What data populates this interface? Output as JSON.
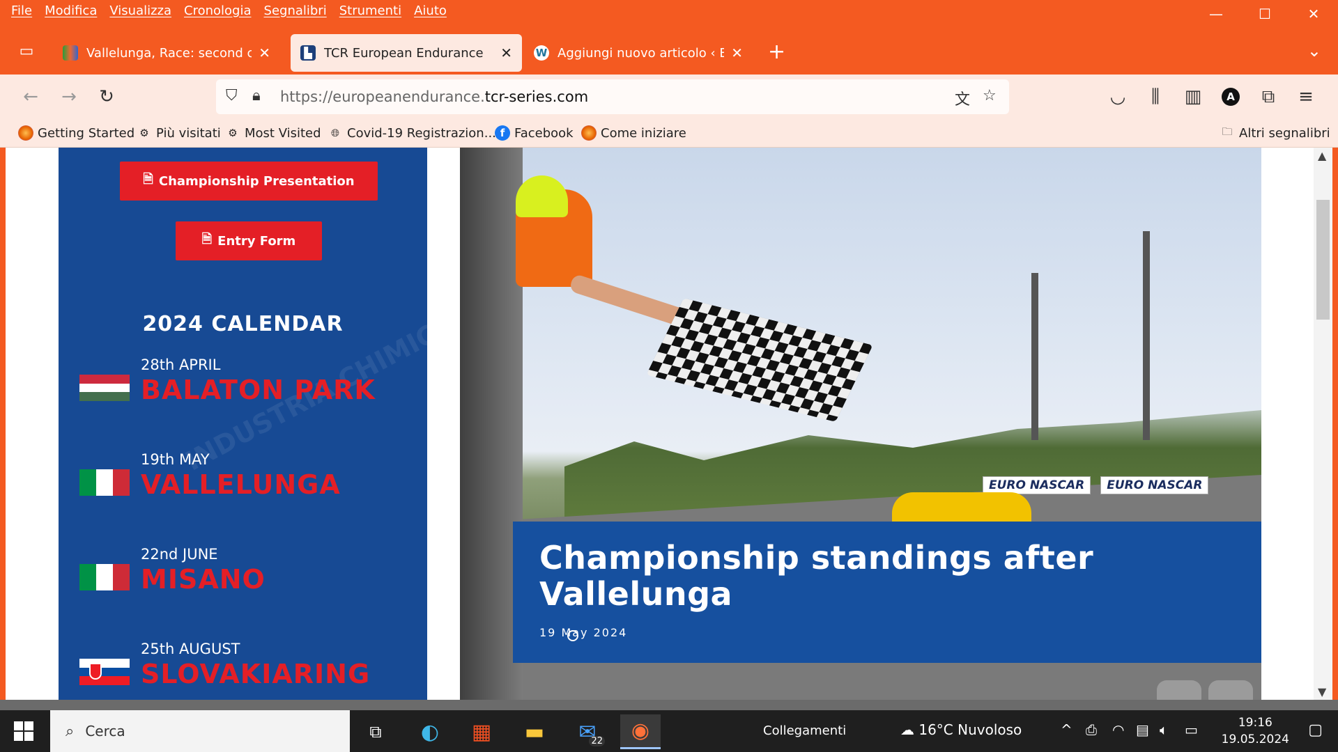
{
  "menubar": [
    "File",
    "Modifica",
    "Visualizza",
    "Cronologia",
    "Segnalibri",
    "Strumenti",
    "Aiuto"
  ],
  "tabs": [
    {
      "title": "Vallelunga, Race: second conse",
      "active": false
    },
    {
      "title": "TCR European Endurance",
      "active": true
    },
    {
      "title": "Aggiungi nuovo articolo ‹ ETiCi",
      "active": false
    }
  ],
  "address": {
    "prefix": "https://europeanendurance.",
    "domain": "tcr-series.com"
  },
  "bookmarks": [
    {
      "label": "Getting Started",
      "icon": "firefox-icon"
    },
    {
      "label": "Più visitati",
      "icon": "gear-icon"
    },
    {
      "label": "Most Visited",
      "icon": "gear-icon"
    },
    {
      "label": "Covid-19 Registrazion...",
      "icon": "globe-icon"
    },
    {
      "label": "Facebook",
      "icon": "facebook-icon"
    },
    {
      "label": "Come iniziare",
      "icon": "firefox-icon"
    }
  ],
  "other_bookmarks": "Altri segnalibri",
  "sidebar": {
    "presentation_btn": "Championship Presentation",
    "entry_btn": "Entry Form",
    "calendar_title": "2024 CALENDAR",
    "races": [
      {
        "date": "28th APRIL",
        "venue": "BALATON PARK",
        "flag": "hungary"
      },
      {
        "date": "19th MAY",
        "venue": "VALLELUNGA",
        "flag": "italy"
      },
      {
        "date": "22nd JUNE",
        "venue": "MISANO",
        "flag": "italy"
      },
      {
        "date": "25th AUGUST",
        "venue": "SLOVAKIARING",
        "flag": "slovakia"
      }
    ]
  },
  "hero": {
    "headline": "Championship standings after Vallelunga",
    "date": "19 May 2024",
    "ads": [
      "EURO NASCAR",
      "EURO NASCAR"
    ]
  },
  "taskbar": {
    "search": "Cerca",
    "links": "Collegamenti",
    "weather": "16°C  Nuvoloso",
    "mail_badge": "22",
    "time": "19:16",
    "date": "19.05.2024"
  },
  "colors": {
    "browser_accent": "#f45a21",
    "sidebar_bg": "#174a94",
    "accent_red": "#e41f26",
    "caption_bg": "#16509f"
  }
}
